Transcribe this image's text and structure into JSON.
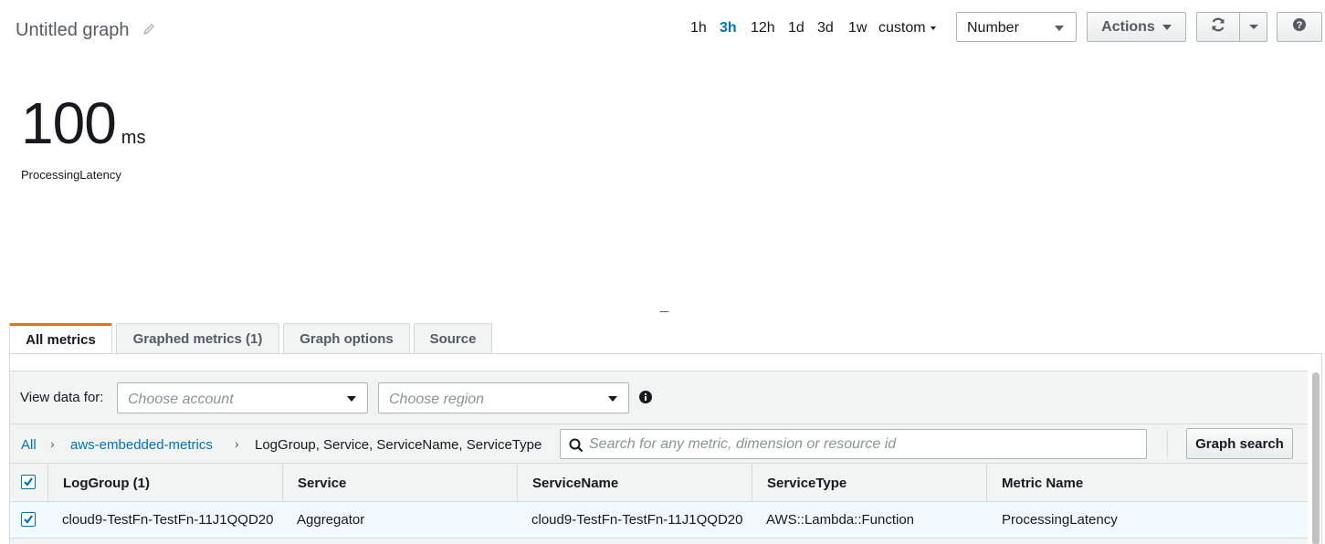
{
  "header": {
    "title": "Untitled graph",
    "time_ranges": [
      "1h",
      "3h",
      "12h",
      "1d",
      "3d",
      "1w"
    ],
    "active_range": "3h",
    "custom_label": "custom",
    "view_type": "Number",
    "actions_label": "Actions"
  },
  "widget": {
    "value": "100",
    "unit": "ms",
    "metric_label": "ProcessingLatency",
    "handle": "---"
  },
  "tabs": [
    {
      "label": "All metrics",
      "active": true
    },
    {
      "label": "Graphed metrics (1)",
      "active": false
    },
    {
      "label": "Graph options",
      "active": false
    },
    {
      "label": "Source",
      "active": false
    }
  ],
  "filters": {
    "view_data_label": "View data for:",
    "account_placeholder": "Choose account",
    "region_placeholder": "Choose region"
  },
  "breadcrumb": {
    "items": [
      "All",
      "aws-embedded-metrics",
      "LogGroup, Service, ServiceName, ServiceType"
    ],
    "search_placeholder": "Search for any metric, dimension or resource id",
    "search_button": "Graph search"
  },
  "table": {
    "columns": [
      "LogGroup  (1)",
      "Service",
      "ServiceName",
      "ServiceType",
      "Metric Name"
    ],
    "rows": [
      [
        "cloud9-TestFn-TestFn-11J1QQD20",
        "Aggregator",
        "cloud9-TestFn-TestFn-11J1QQD20",
        "AWS::Lambda::Function",
        "ProcessingLatency"
      ]
    ]
  },
  "colors": {
    "accent_blue": "#0073bb",
    "tab_orange": "#ec7211",
    "row_selected": "#f1faff"
  },
  "icons": [
    "pencil-icon",
    "refresh-icon",
    "help-icon",
    "info-icon",
    "search-icon",
    "checkbox-checked-icon"
  ]
}
